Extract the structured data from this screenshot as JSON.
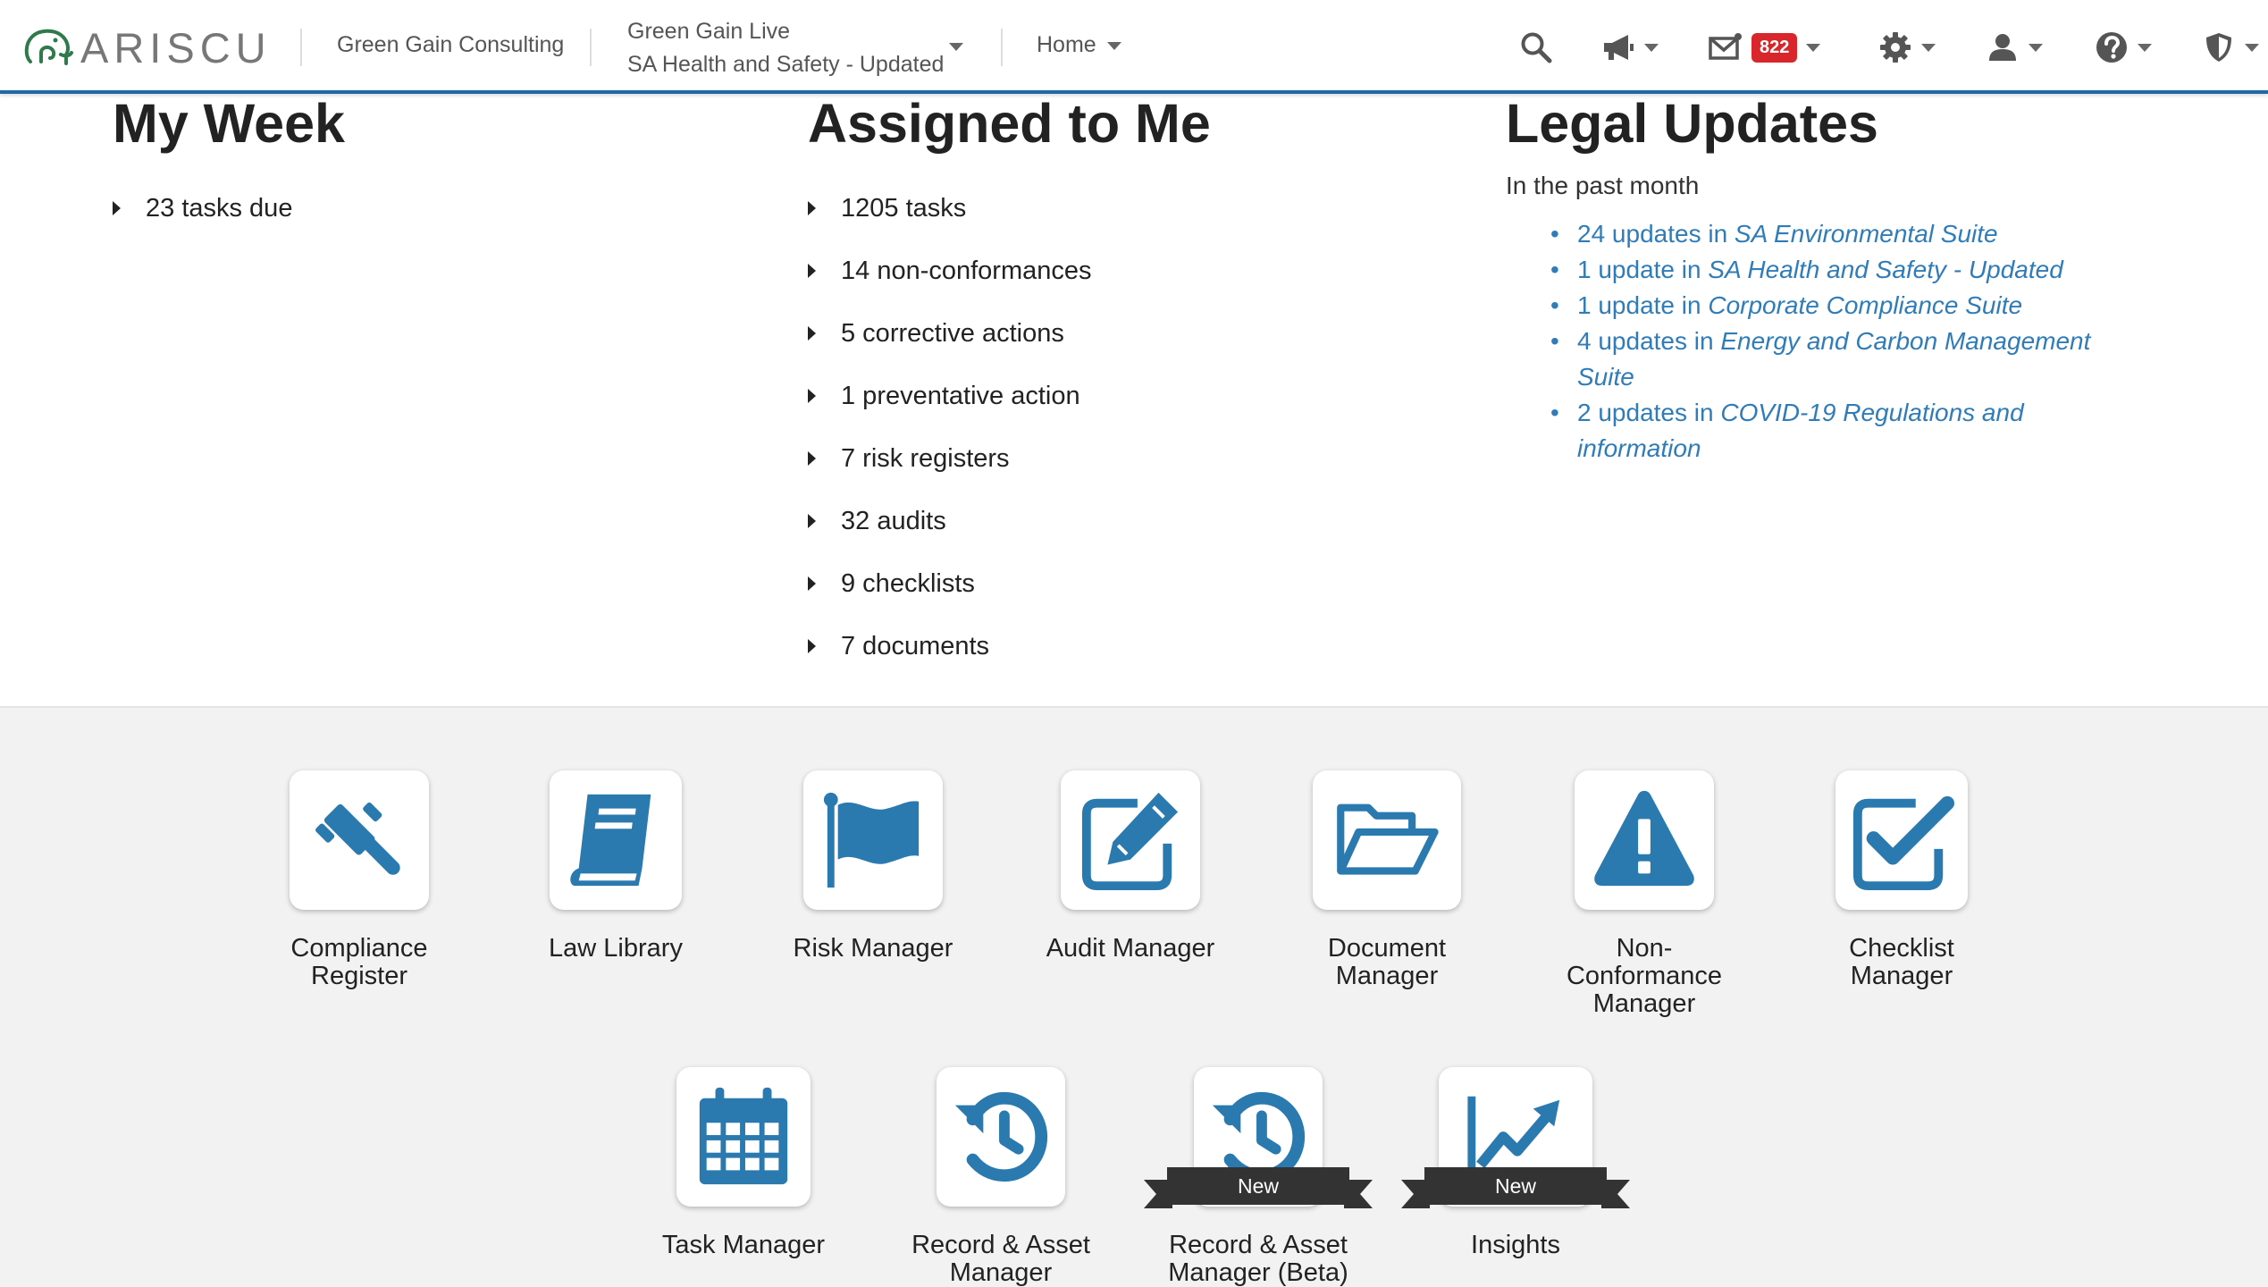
{
  "header": {
    "logo_text": "ARISCU",
    "organization": "Green Gain Consulting",
    "instance_title": "Green Gain Live",
    "instance_subtitle": "SA Health and Safety - Updated",
    "home_label": "Home",
    "inbox_count": "822"
  },
  "my_week": {
    "title": "My Week",
    "items": [
      {
        "label": "23 tasks due"
      }
    ]
  },
  "assigned": {
    "title": "Assigned to Me",
    "items": [
      {
        "label": "1205 tasks"
      },
      {
        "label": "14 non-conformances"
      },
      {
        "label": "5 corrective actions"
      },
      {
        "label": "1 preventative action"
      },
      {
        "label": "7 risk registers"
      },
      {
        "label": "32 audits"
      },
      {
        "label": "9 checklists"
      },
      {
        "label": "7 documents"
      }
    ]
  },
  "legal": {
    "title": "Legal Updates",
    "subtitle": "In the past month",
    "items": [
      {
        "count": "24 updates in ",
        "suite": "SA Environmental Suite"
      },
      {
        "count": "1 update in ",
        "suite": "SA Health and Safety - Updated"
      },
      {
        "count": "1 update in ",
        "suite": "Corporate Compliance Suite"
      },
      {
        "count": "4 updates in ",
        "suite": "Energy and Carbon Management Suite"
      },
      {
        "count": "2 updates in ",
        "suite": "COVID-19 Regulations and information"
      }
    ]
  },
  "apps": [
    {
      "label": "Compliance Register",
      "icon": "gavel-icon"
    },
    {
      "label": "Law Library",
      "icon": "book-icon"
    },
    {
      "label": "Risk Manager",
      "icon": "flag-icon"
    },
    {
      "label": "Audit Manager",
      "icon": "edit-icon"
    },
    {
      "label": "Document Manager",
      "icon": "folder-open-icon"
    },
    {
      "label": "Non-Conformance Manager",
      "icon": "warning-icon"
    },
    {
      "label": "Checklist Manager",
      "icon": "checkbox-icon"
    },
    {
      "label": "Task Manager",
      "icon": "calendar-icon"
    },
    {
      "label": "Record & Asset Manager",
      "icon": "history-icon"
    },
    {
      "label": "Record & Asset Manager (Beta)",
      "icon": "history-icon",
      "ribbon": "New"
    },
    {
      "label": "Insights",
      "icon": "line-chart-icon",
      "ribbon": "New"
    }
  ],
  "colors": {
    "accent": "#2a7ab0",
    "link": "#2f7cb8",
    "badge": "#d9262a",
    "ribbon": "#333333"
  }
}
